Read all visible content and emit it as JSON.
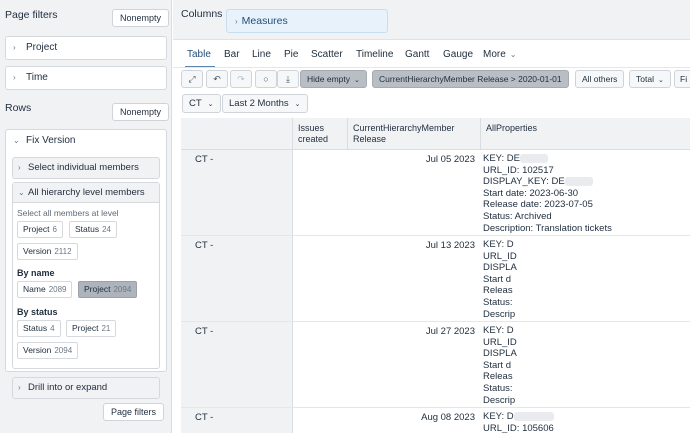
{
  "left": {
    "page_filters": {
      "title": "Page filters",
      "nonempty": "Nonempty"
    },
    "filters": [
      {
        "label": "Project"
      },
      {
        "label": "Time"
      }
    ],
    "rows": {
      "title": "Rows",
      "nonempty": "Nonempty"
    },
    "fix_version": {
      "title": "Fix Version",
      "select_individual": "Select individual members",
      "all_levels": {
        "title": "All hierarchy level members",
        "select_all_label": "Select all members at level",
        "level_chips": [
          {
            "name": "Project",
            "count": "6"
          },
          {
            "name": "Status",
            "count": "24"
          },
          {
            "name": "Version",
            "count": "2112"
          }
        ],
        "by_name_label": "By name",
        "by_name_chips": [
          {
            "name": "Name",
            "count": "2089"
          },
          {
            "name": "Project",
            "count": "2094"
          }
        ],
        "by_status_label": "By status",
        "by_status_chips": [
          {
            "name": "Status",
            "count": "4"
          },
          {
            "name": "Project",
            "count": "21"
          },
          {
            "name": "Version",
            "count": "2094"
          }
        ]
      },
      "drill": "Drill into or expand"
    },
    "page_filters_button": "Page filters"
  },
  "right": {
    "columns_title": "Columns",
    "measures": "Measures",
    "tabs": [
      "Table",
      "Bar",
      "Line",
      "Pie",
      "Scatter",
      "Timeline",
      "Gantt",
      "Gauge",
      "More"
    ],
    "toolbar": {
      "hide_empty": "Hide empty",
      "hierarchy_filter": "CurrentHierarchyMember Release > 2020-01-01",
      "all_others": "All others",
      "total": "Total",
      "cut": "Fi"
    },
    "selectors": {
      "ct": "CT",
      "period": "Last 2 Months"
    },
    "table": {
      "headers": [
        "Issues created",
        "CurrentHierarchyMember Release",
        "AllProperties"
      ],
      "rows": [
        {
          "member": "CT -",
          "release": "Jul 05 2023",
          "props": [
            "KEY: DE",
            "URL_ID: 102517",
            "DISPLAY_KEY: DE",
            "Start date: 2023-06-30",
            "Release date: 2023-07-05",
            "Status: Archived",
            "Description: Translation tickets"
          ]
        },
        {
          "member": "CT -",
          "release": "Jul 13 2023",
          "props": [
            "KEY: D",
            "URL_ID",
            "DISPLA",
            "Start d",
            "Releas",
            "Status:",
            "Descrip"
          ]
        },
        {
          "member": "CT -",
          "release": "Jul 27 2023",
          "props": [
            "KEY: D",
            "URL_ID",
            "DISPLA",
            "Start d",
            "Releas",
            "Status:",
            "Descrip"
          ]
        },
        {
          "member": "CT -",
          "release": "Aug 08 2023",
          "props": [
            "KEY: D",
            "URL_ID: 105606"
          ]
        }
      ]
    }
  }
}
